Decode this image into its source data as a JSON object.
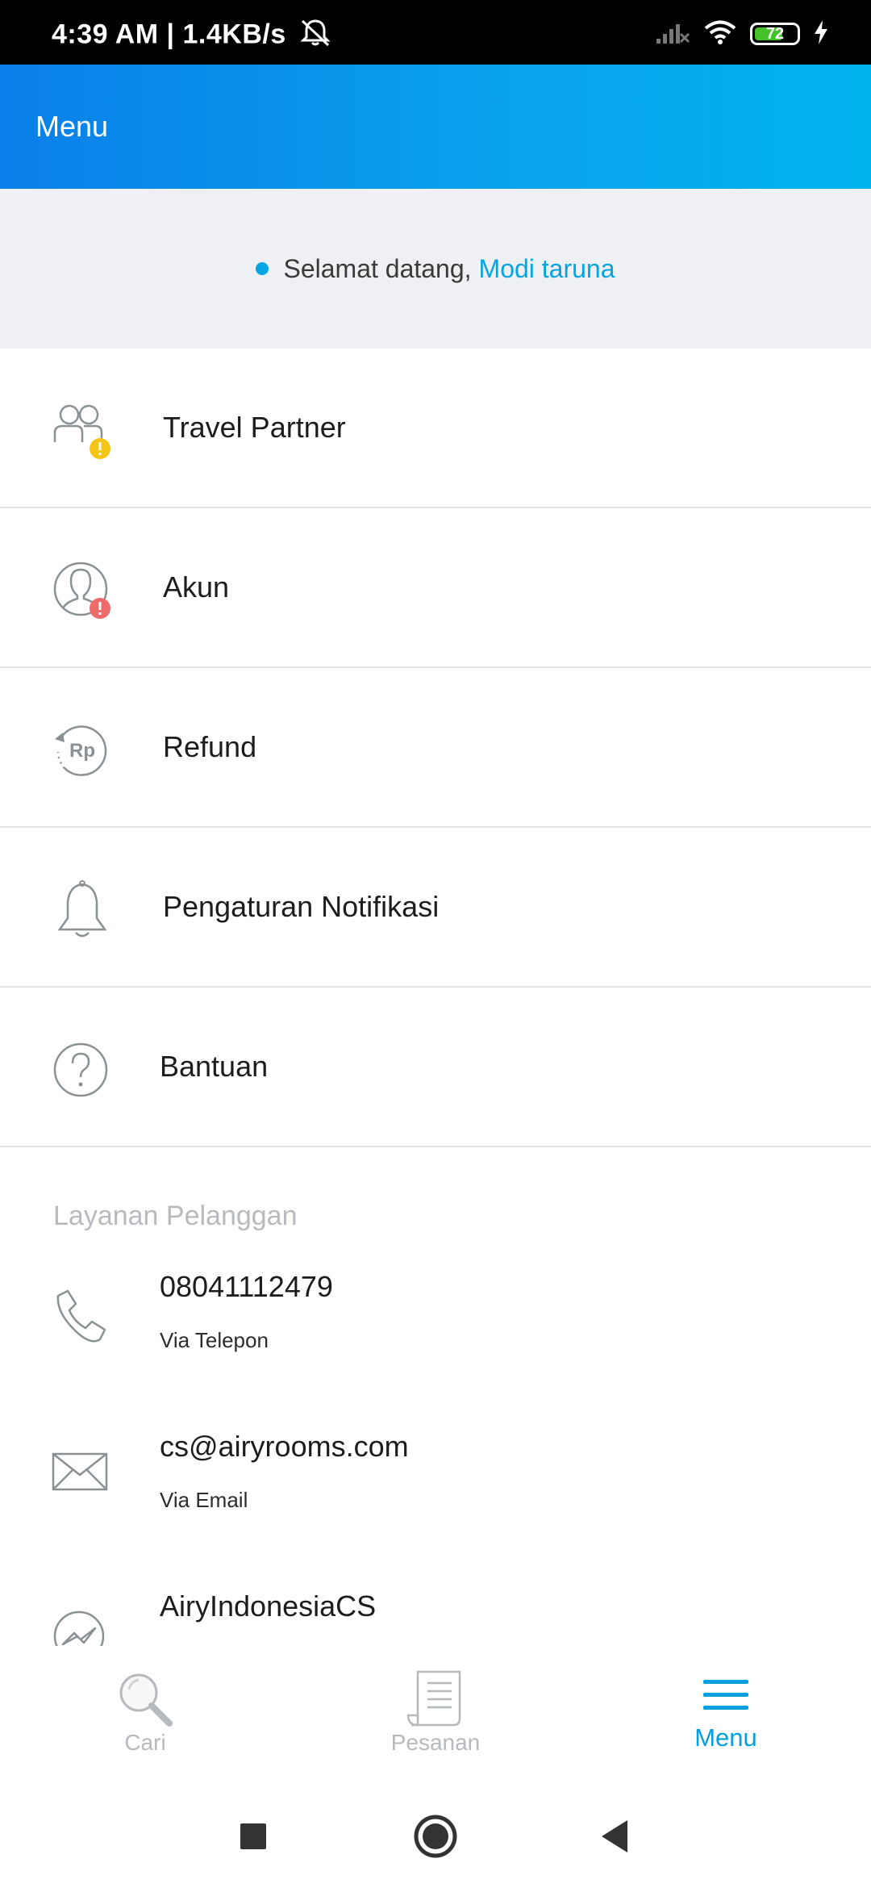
{
  "status_bar": {
    "time": "4:39 AM | 1.4KB/s",
    "battery": "72",
    "battery_level": 0.72
  },
  "app_bar": {
    "title": "Menu"
  },
  "welcome": {
    "greeting": "Selamat datang,",
    "user_name": "Modi taruna"
  },
  "menu_items": [
    {
      "label": "Travel Partner",
      "icon": "people-icon"
    },
    {
      "label": "Akun",
      "icon": "account-icon"
    },
    {
      "label": "Refund",
      "icon": "refund-icon"
    },
    {
      "label": "Pengaturan Notifikasi",
      "icon": "bell-icon"
    },
    {
      "label": "Bantuan",
      "icon": "help-icon"
    }
  ],
  "customer_service": {
    "title": "Layanan Pelanggan",
    "items": [
      {
        "value": "08041112479",
        "subtitle": "Via Telepon",
        "icon": "phone-icon"
      },
      {
        "value": "cs@airyrooms.com",
        "subtitle": "Via Email",
        "icon": "email-icon"
      },
      {
        "value": "AiryIndonesiaCS",
        "subtitle": "",
        "icon": "messenger-icon"
      }
    ]
  },
  "bottom_nav": {
    "tabs": [
      {
        "label": "Cari",
        "icon": "search-icon",
        "active": false
      },
      {
        "label": "Pesanan",
        "icon": "receipt-icon",
        "active": false
      },
      {
        "label": "Menu",
        "icon": "hamburger-icon",
        "active": true
      }
    ]
  },
  "colors": {
    "accent": "#03a6e3",
    "appbar_start": "#0a7fe9",
    "appbar_end": "#02b4ee",
    "warning_badge": "#f5c518",
    "alert_badge": "#ef6b6b",
    "icon_gray": "#8a9194"
  }
}
